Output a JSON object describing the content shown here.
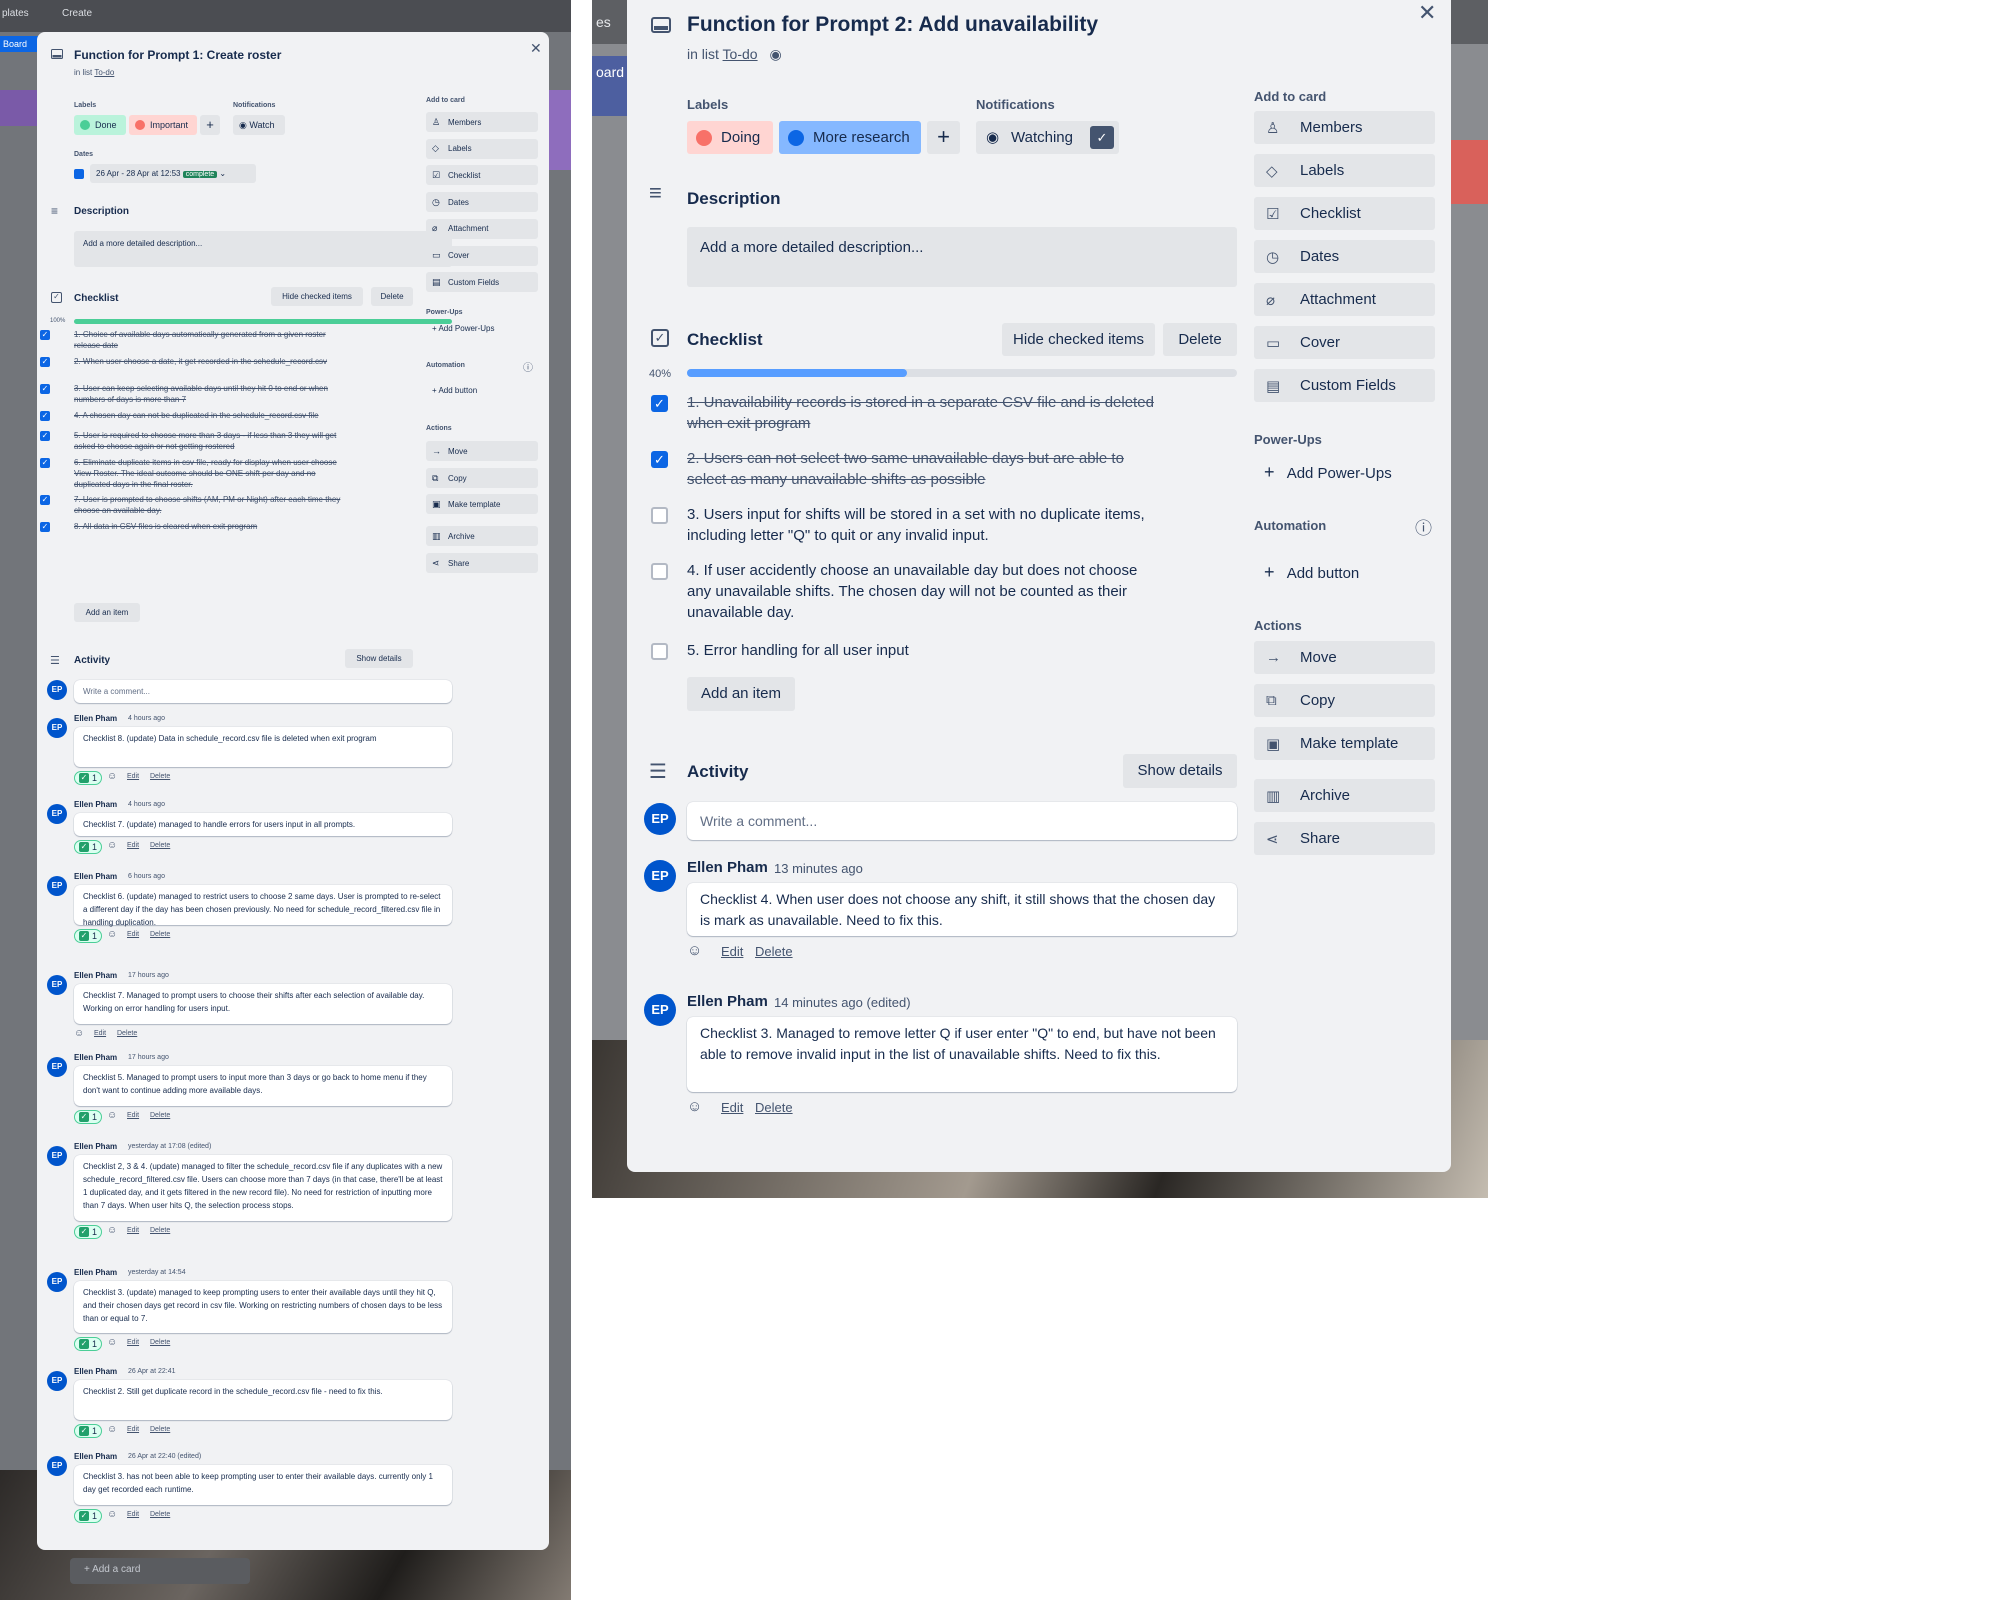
{
  "left_background": {
    "top_tabs": [
      "plates",
      "Create"
    ],
    "board_tab": "Board",
    "add_card": "+ Add a card"
  },
  "left_card": {
    "title": "Function for Prompt 1: Create roster",
    "in_list_prefix": "in list",
    "list_name": "To-do",
    "labels_heading": "Labels",
    "labels": [
      {
        "text": "Done",
        "bg": "#baf3db",
        "dot": "#4bce97"
      },
      {
        "text": "Important",
        "bg": "#ffd5d2",
        "dot": "#f87168"
      }
    ],
    "notifications_heading": "Notifications",
    "watch_label": "Watch",
    "dates_heading": "Dates",
    "dates_value": "26 Apr - 28 Apr at 12:53",
    "dates_badge": "complete",
    "description_heading": "Description",
    "description_placeholder": "Add a more detailed description...",
    "checklist_heading": "Checklist",
    "hide_checked": "Hide checked items",
    "delete": "Delete",
    "progress_label": "100%",
    "progress": 1.0,
    "checklist_items": [
      "1. Choice of available days automatically generated from a given roster release date",
      "2. When user choose a date, it get recorded in the schedule_record.csv",
      "3. User can keep selecting available days until they hit 0 to end or when numbers of days is more than 7",
      "4. A chosen day can not be duplicated in the schedule_record.csv file",
      "5. User is required to choose more than 3 days - if less than 3 they will get asked to choose again or not getting rostered",
      "6. Eliminate duplicate items in csv file, ready for display when user choose View Roster. The ideal outcome should be ONE shift per day and no duplicated days in the final roster.",
      "7. User is prompted to choose shifts (AM, PM or Night) after each time they choose an available day.",
      "8. All data in CSV files is cleared when exit program"
    ],
    "add_item": "Add an item",
    "activity_heading": "Activity",
    "show_details": "Show details",
    "comment_placeholder": "Write a comment...",
    "avatar_initials": "EP",
    "edit": "Edit",
    "delete_link": "Delete",
    "activities": [
      {
        "author": "Ellen Pham",
        "time": "4 hours ago",
        "text": "Checklist 8. (update) Data in schedule_record.csv file is deleted when exit program",
        "reaction": "1"
      },
      {
        "author": "Ellen Pham",
        "time": "4 hours ago",
        "text": "Checklist 7. (update) managed to handle errors for users input in all prompts.",
        "reaction": "1"
      },
      {
        "author": "Ellen Pham",
        "time": "6 hours ago",
        "text": "Checklist 6. (update) managed to restrict users to choose 2 same days. User is prompted to re-select a different day if the day has been chosen previously. No need for schedule_record_filtered.csv file in handling duplication.",
        "reaction": "1"
      },
      {
        "author": "Ellen Pham",
        "time": "17 hours ago",
        "text": "Checklist 7. Managed to prompt users to choose their shifts after each selection of available day. Working on error handling for users input.",
        "reaction": ""
      },
      {
        "author": "Ellen Pham",
        "time": "17 hours ago",
        "text": "Checklist 5. Managed to prompt users to input more than 3 days or go back to home menu if they don't want to continue adding more available days.",
        "reaction": "1"
      },
      {
        "author": "Ellen Pham",
        "time": "yesterday at 17:08 (edited)",
        "text": "Checklist 2, 3 & 4. (update) managed to filter the schedule_record.csv file if any duplicates with a new schedule_record_filtered.csv file. Users can choose more than 7 days (in that case, there'll be at least 1 duplicated day, and it gets filtered in the new record file). No need for restriction of inputting more than 7 days. When user hits Q, the selection process stops.",
        "reaction": "1"
      },
      {
        "author": "Ellen Pham",
        "time": "yesterday at 14:54",
        "text": "Checklist 3. (update) managed to keep prompting users to enter their available days until they hit Q, and their chosen days get record in csv file. Working on restricting numbers of chosen days to be less than or equal to 7.",
        "reaction": "1"
      },
      {
        "author": "Ellen Pham",
        "time": "26 Apr at 22:41",
        "text": "Checklist 2. Still get duplicate record in the schedule_record.csv file - need to fix this.",
        "reaction": "1"
      },
      {
        "author": "Ellen Pham",
        "time": "26 Apr at 22:40 (edited)",
        "text": "Checklist 3. has not been able to keep prompting user to enter their available days. currently only 1 day get recorded each runtime.",
        "reaction": "1"
      }
    ],
    "sidebar": {
      "add_to_card": "Add to card",
      "add_items": [
        {
          "label": "Members",
          "icon": "person-icon"
        },
        {
          "label": "Labels",
          "icon": "tag-icon"
        },
        {
          "label": "Checklist",
          "icon": "checklist-icon"
        },
        {
          "label": "Dates",
          "icon": "clock-icon"
        },
        {
          "label": "Attachment",
          "icon": "paperclip-icon"
        },
        {
          "label": "Cover",
          "icon": "cover-icon"
        },
        {
          "label": "Custom Fields",
          "icon": "custom-fields-icon"
        }
      ],
      "power_ups": "Power-Ups",
      "add_power_ups": "Add Power-Ups",
      "automation": "Automation",
      "add_button": "Add button",
      "actions": "Actions",
      "action_items": [
        {
          "label": "Move",
          "icon": "arrow-right-icon"
        },
        {
          "label": "Copy",
          "icon": "copy-icon"
        },
        {
          "label": "Make template",
          "icon": "template-icon"
        },
        {
          "label": "Archive",
          "icon": "archive-icon"
        },
        {
          "label": "Share",
          "icon": "share-icon"
        }
      ]
    }
  },
  "right_background": {
    "top_text": "es",
    "board_text": "oard"
  },
  "right_card": {
    "title": "Function for Prompt 2: Add unavailability",
    "in_list_prefix": "in list",
    "list_name": "To-do",
    "labels_heading": "Labels",
    "labels": [
      {
        "text": "Doing",
        "bg": "#fdd0ec",
        "dot": "#f87168",
        "pill_bg": "#ffd5d2"
      },
      {
        "text": "More research",
        "bg": "#8fb8f6",
        "dot": "#0c66e4",
        "pill_bg": "#85b8ff"
      }
    ],
    "notifications_heading": "Notifications",
    "watching_label": "Watching",
    "description_heading": "Description",
    "description_placeholder": "Add a more detailed description...",
    "checklist_heading": "Checklist",
    "hide_checked": "Hide checked items",
    "delete": "Delete",
    "progress_label": "40%",
    "progress": 0.4,
    "checklist_items": [
      {
        "text": "1. Unavailability records is stored in a separate CSV file and is deleted when exit program",
        "checked": true
      },
      {
        "text": "2. Users can not select two same unavailable days but are able to select as many unavailable shifts as possible",
        "checked": true
      },
      {
        "text": "3. Users input for shifts will be stored in a set with no duplicate items, including letter \"Q\" to quit or any invalid input.",
        "checked": false
      },
      {
        "text": "4. If user accidently choose an unavailable day but does not choose any unavailable shifts. The chosen day will not be counted as their unavailable day.",
        "checked": false
      },
      {
        "text": "5. Error handling for all user input",
        "checked": false
      }
    ],
    "add_item": "Add an item",
    "activity_heading": "Activity",
    "show_details": "Show details",
    "comment_placeholder": "Write a comment...",
    "avatar_initials": "EP",
    "edit": "Edit",
    "delete_link": "Delete",
    "activities": [
      {
        "author": "Ellen Pham",
        "time": "13 minutes ago",
        "text": "Checklist 4. When user does not choose any shift, it still shows that the chosen day is mark as unavailable. Need to fix this."
      },
      {
        "author": "Ellen Pham",
        "time": "14 minutes ago (edited)",
        "text": "Checklist 3. Managed to remove letter Q if user enter \"Q\" to end, but have not been able to remove invalid input in the list of unavailable shifts. Need to fix this."
      }
    ],
    "sidebar": {
      "add_to_card": "Add to card",
      "add_items": [
        {
          "label": "Members",
          "icon": "person-icon"
        },
        {
          "label": "Labels",
          "icon": "tag-icon"
        },
        {
          "label": "Checklist",
          "icon": "checklist-icon"
        },
        {
          "label": "Dates",
          "icon": "clock-icon"
        },
        {
          "label": "Attachment",
          "icon": "paperclip-icon"
        },
        {
          "label": "Cover",
          "icon": "cover-icon"
        },
        {
          "label": "Custom Fields",
          "icon": "custom-fields-icon"
        }
      ],
      "power_ups": "Power-Ups",
      "add_power_ups": "Add Power-Ups",
      "automation": "Automation",
      "add_button": "Add button",
      "actions": "Actions",
      "action_items": [
        {
          "label": "Move",
          "icon": "arrow-right-icon"
        },
        {
          "label": "Copy",
          "icon": "copy-icon"
        },
        {
          "label": "Make template",
          "icon": "template-icon"
        },
        {
          "label": "Archive",
          "icon": "archive-icon"
        },
        {
          "label": "Share",
          "icon": "share-icon"
        }
      ]
    }
  },
  "colors": {
    "card_bg": "#f1f2f4",
    "progress_fill_left": "#4bce97",
    "progress_fill_right": "#579dff",
    "checkbox": "#0c66e4",
    "avatar": "#0055cc",
    "watch_active": "#44546f"
  }
}
